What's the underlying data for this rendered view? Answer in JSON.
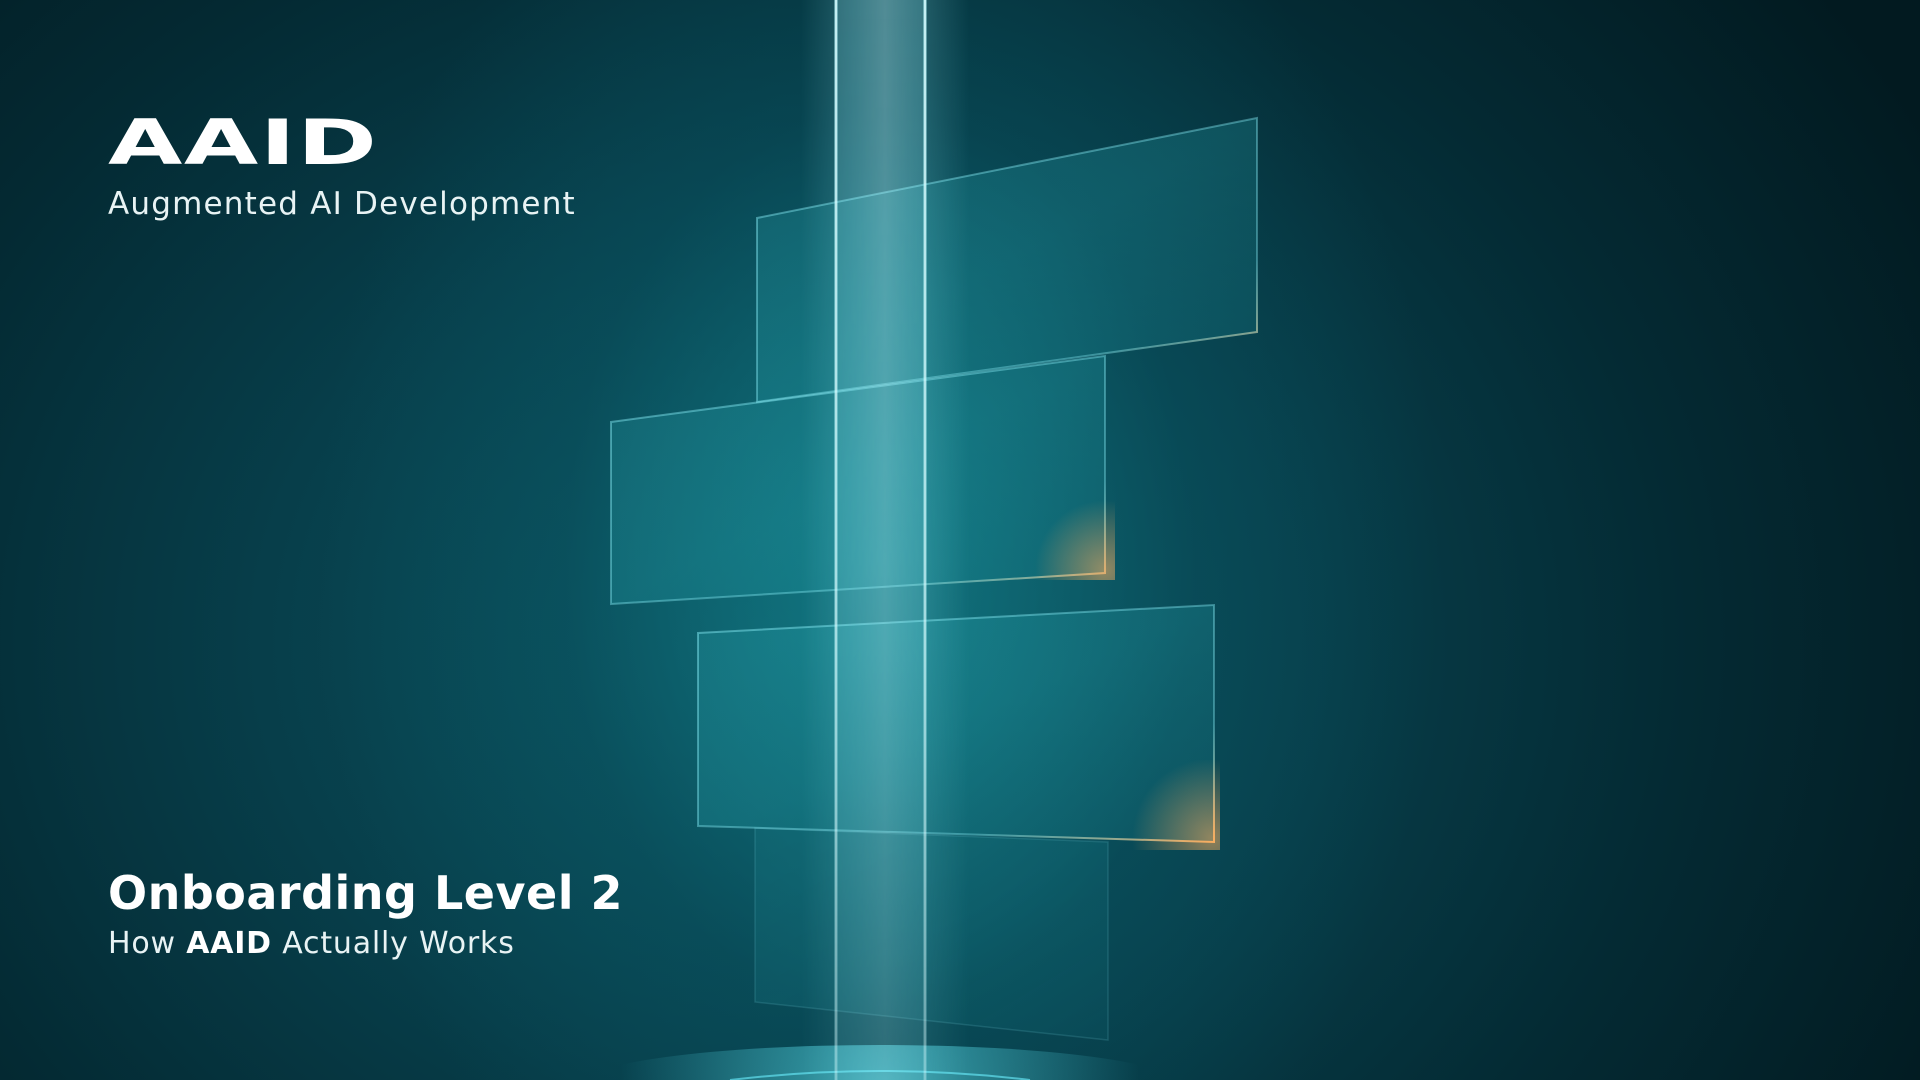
{
  "brand": {
    "logo": "AAID",
    "tagline": "Augmented AI Development"
  },
  "title_block": {
    "title": "Onboarding Level 2",
    "subtitle_prefix": "How ",
    "subtitle_emphasis": "AAID",
    "subtitle_suffix": " Actually Works"
  },
  "colors": {
    "background_dark": "#021a1f",
    "background_teal": "#0b5561",
    "glow_cyan": "#8ff5ff",
    "accent_orange": "#ffb060"
  },
  "icons": {
    "artwork": "light-beam-glass-panels"
  }
}
